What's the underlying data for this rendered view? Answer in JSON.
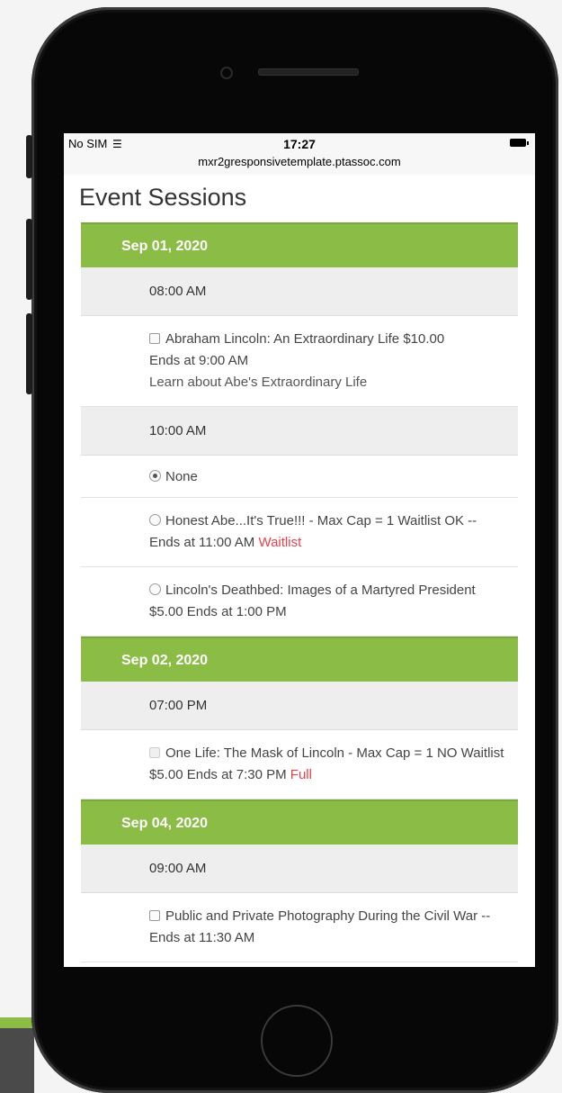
{
  "status_bar": {
    "carrier": "No SIM",
    "wifi_icon": "wifi-icon",
    "time": "17:27",
    "url": "mxr2gresponsivetemplate.ptassoc.com",
    "battery_icon": "battery-icon"
  },
  "page": {
    "title": "Event Sessions"
  },
  "days": [
    {
      "date": "Sep 01, 2020",
      "slots": [
        {
          "time": "08:00 AM",
          "sessions": [
            {
              "control": "checkbox",
              "checked": false,
              "enabled": true,
              "name": "Abraham Lincoln: An Extraordinary Life",
              "price": "$10.00",
              "ends": "Ends at 9:00 AM",
              "description": "Learn about Abe's Extraordinary Life",
              "status": ""
            }
          ]
        },
        {
          "time": "10:00 AM",
          "sessions": [
            {
              "control": "radio",
              "checked": true,
              "enabled": true,
              "name": "None"
            },
            {
              "control": "radio",
              "checked": false,
              "enabled": true,
              "name": "Honest Abe...It's True!!! - Max Cap = 1 Waitlist OK --",
              "price": "",
              "ends": "Ends at 11:00 AM",
              "status": "Waitlist"
            },
            {
              "control": "radio",
              "checked": false,
              "enabled": true,
              "name": "Lincoln's Deathbed: Images of a Martyred President",
              "price": "$5.00",
              "ends": "Ends at 1:00 PM",
              "status": ""
            }
          ]
        }
      ]
    },
    {
      "date": "Sep 02, 2020",
      "slots": [
        {
          "time": "07:00 PM",
          "sessions": [
            {
              "control": "checkbox",
              "checked": false,
              "enabled": false,
              "name": "One Life: The Mask of Lincoln - Max Cap = 1 NO Waitlist",
              "price": "$5.00",
              "ends": "Ends at 7:30 PM",
              "status": "Full"
            }
          ]
        }
      ]
    },
    {
      "date": "Sep 04, 2020",
      "slots": [
        {
          "time": "09:00 AM",
          "sessions": [
            {
              "control": "checkbox",
              "checked": false,
              "enabled": true,
              "name": "Public and Private Photography During the Civil War --",
              "price": "",
              "ends": "Ends at 11:30 AM",
              "status": ""
            }
          ]
        }
      ]
    }
  ],
  "colors": {
    "accent": "#8bbd46",
    "status_red": "#e8424a",
    "row_gray": "#eeeeee"
  }
}
